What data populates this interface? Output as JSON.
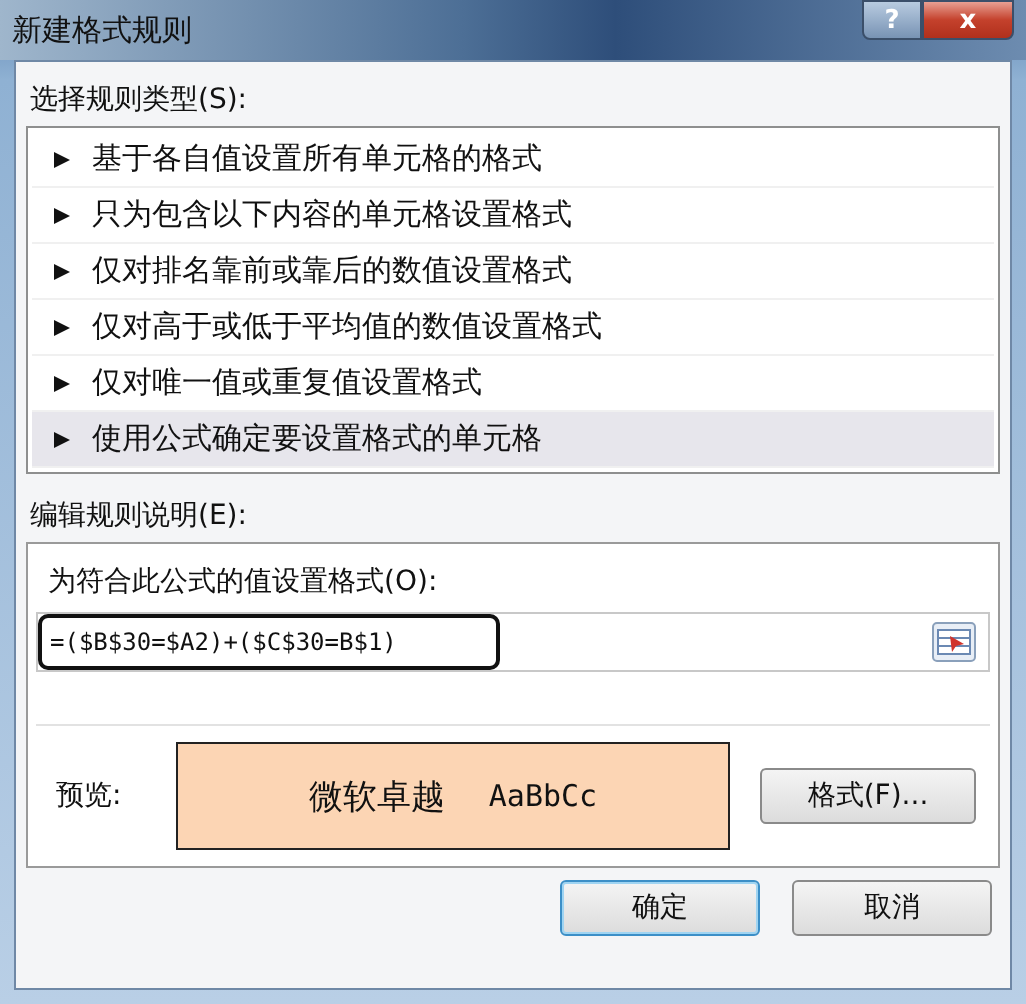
{
  "window": {
    "title": "新建格式规则",
    "help_button": "?",
    "close_button": "x"
  },
  "rule_type": {
    "label": "选择规则类型(S):",
    "items": [
      {
        "label": "基于各自值设置所有单元格的格式",
        "selected": false
      },
      {
        "label": "只为包含以下内容的单元格设置格式",
        "selected": false
      },
      {
        "label": "仅对排名靠前或靠后的数值设置格式",
        "selected": false
      },
      {
        "label": "仅对高于或低于平均值的数值设置格式",
        "selected": false
      },
      {
        "label": "仅对唯一值或重复值设置格式",
        "selected": false
      },
      {
        "label": "使用公式确定要设置格式的单元格",
        "selected": true
      }
    ]
  },
  "rule_description": {
    "label": "编辑规则说明(E):",
    "formula_label": "为符合此公式的值设置格式(O):",
    "formula": "=($B$30=$A2)+($C$30=B$1)",
    "preview_label": "预览:",
    "preview_text": "微软卓越",
    "preview_latin": "AaBbCc",
    "format_button": "格式(F)..."
  },
  "buttons": [
    "确定",
    "取消"
  ]
}
